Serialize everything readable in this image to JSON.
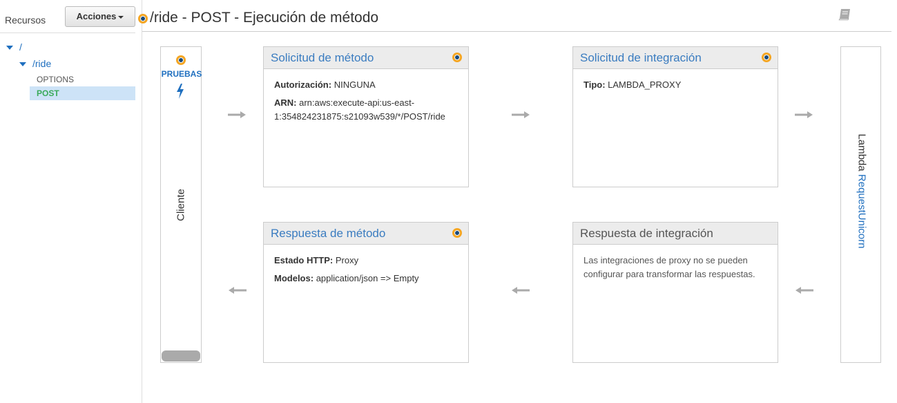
{
  "sidebar": {
    "title": "Recursos",
    "actions_label": "Acciones",
    "tree": {
      "root": "/",
      "ride": "/ride",
      "methods": [
        "OPTIONS",
        "POST"
      ]
    }
  },
  "header": {
    "title": "/ride - POST - Ejecución de método"
  },
  "client": {
    "test_label": "PRUEBAS",
    "label": "Cliente"
  },
  "method_request": {
    "title": "Solicitud de método",
    "auth_key": "Autorización:",
    "auth_value": "NINGUNA",
    "arn_key": "ARN:",
    "arn_value_line1": "arn:aws:execute-api:us-east-",
    "arn_value_line2": "1:354824231875:s21093w539/*/POST/ride"
  },
  "integration_request": {
    "title": "Solicitud de integración",
    "type_key": "Tipo:",
    "type_value": "LAMBDA_PROXY"
  },
  "method_response": {
    "title": "Respuesta de método",
    "status_key": "Estado HTTP:",
    "status_value": "Proxy",
    "models_key": "Modelos:",
    "models_value": "application/json => Empty"
  },
  "integration_response": {
    "title": "Respuesta de integración",
    "note": "Las integraciones de proxy no se pueden configurar para transformar las respuestas."
  },
  "lambda": {
    "prefix": "Lambda",
    "function": "RequestUnicorn"
  },
  "colors": {
    "link": "#3a7cc0",
    "accent_dot": "#f5a623",
    "selected_row": "#cde3f7",
    "post_method": "#3aaa5a"
  }
}
